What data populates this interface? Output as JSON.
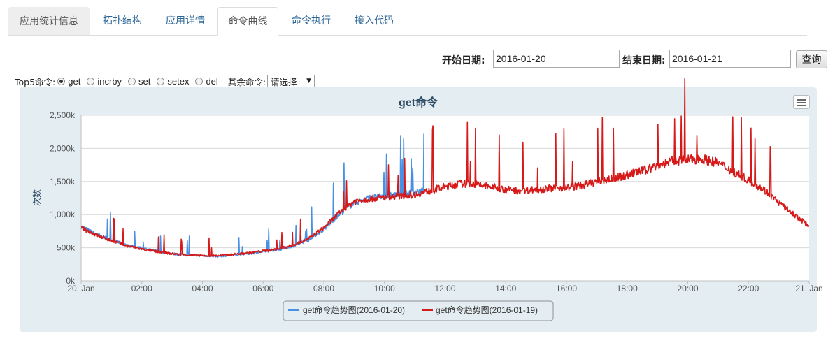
{
  "tabs": [
    {
      "label": "应用统计信息"
    },
    {
      "label": "拓扑结构"
    },
    {
      "label": "应用详情"
    },
    {
      "label": "命令曲线"
    },
    {
      "label": "命令执行"
    },
    {
      "label": "接入代码"
    }
  ],
  "filter": {
    "start_label": "开始日期:",
    "start_value": "2016-01-20",
    "end_label": "结束日期:",
    "end_value": "2016-01-21",
    "query_label": "查询"
  },
  "commands": {
    "top5_label": "Top5命令:",
    "options": [
      "get",
      "incrby",
      "set",
      "setex",
      "del"
    ],
    "selected": "get",
    "other_label": "其余命令:",
    "other_select": "请选择"
  },
  "icons": {
    "menu": "hamburger-menu-icon"
  },
  "chart_data": {
    "type": "line",
    "title": "get命令",
    "ylabel": "次数",
    "xlabel": "",
    "ylim": [
      0,
      2500000
    ],
    "y_ticks": [
      "0k",
      "500k",
      "1,000k",
      "1,500k",
      "2,000k",
      "2,500k"
    ],
    "x_ticks": [
      "20. Jan",
      "02:00",
      "04:00",
      "06:00",
      "08:00",
      "10:00",
      "12:00",
      "14:00",
      "16:00",
      "18:00",
      "20:00",
      "22:00",
      "21. Jan"
    ],
    "xlim_hours": [
      0,
      24
    ],
    "grid": true,
    "legend_position": "bottom-center",
    "x_unit": "hour",
    "series": [
      {
        "name": "get命令趋势图(2016-01-20)",
        "color": "#4a90e2",
        "x": [
          0,
          0.5,
          1,
          1.5,
          2,
          2.5,
          3,
          3.5,
          4,
          4.5,
          5,
          5.5,
          6,
          6.5,
          7,
          7.5,
          8,
          8.5,
          9,
          9.5,
          10,
          10.5,
          11,
          11.3
        ],
        "values": [
          820000,
          700000,
          620000,
          540000,
          490000,
          450000,
          410000,
          390000,
          380000,
          370000,
          390000,
          410000,
          440000,
          470000,
          530000,
          620000,
          780000,
          1000000,
          1180000,
          1250000,
          1280000,
          1300000,
          1330000,
          1360000
        ]
      },
      {
        "name": "get命令趋势图(2016-01-19)",
        "color": "#d61a1a",
        "x": [
          0,
          0.5,
          1,
          1.5,
          2,
          2.5,
          3,
          3.5,
          4,
          4.5,
          5,
          5.5,
          6,
          6.5,
          7,
          7.5,
          8,
          8.5,
          9,
          9.5,
          10,
          10.5,
          11,
          11.5,
          12,
          12.5,
          13,
          13.5,
          14,
          14.5,
          15,
          15.5,
          16,
          16.5,
          17,
          17.5,
          18,
          18.5,
          19,
          19.5,
          20,
          20.5,
          21,
          21.5,
          22,
          22.5,
          23,
          23.5,
          24
        ],
        "values": [
          800000,
          690000,
          610000,
          530000,
          480000,
          440000,
          410000,
          390000,
          380000,
          380000,
          400000,
          420000,
          450000,
          480000,
          540000,
          640000,
          800000,
          1020000,
          1200000,
          1240000,
          1260000,
          1280000,
          1300000,
          1360000,
          1420000,
          1470000,
          1460000,
          1420000,
          1380000,
          1360000,
          1380000,
          1400000,
          1410000,
          1440000,
          1500000,
          1540000,
          1600000,
          1660000,
          1740000,
          1810000,
          1830000,
          1840000,
          1780000,
          1650000,
          1520000,
          1380000,
          1180000,
          1000000,
          830000
        ]
      }
    ]
  }
}
